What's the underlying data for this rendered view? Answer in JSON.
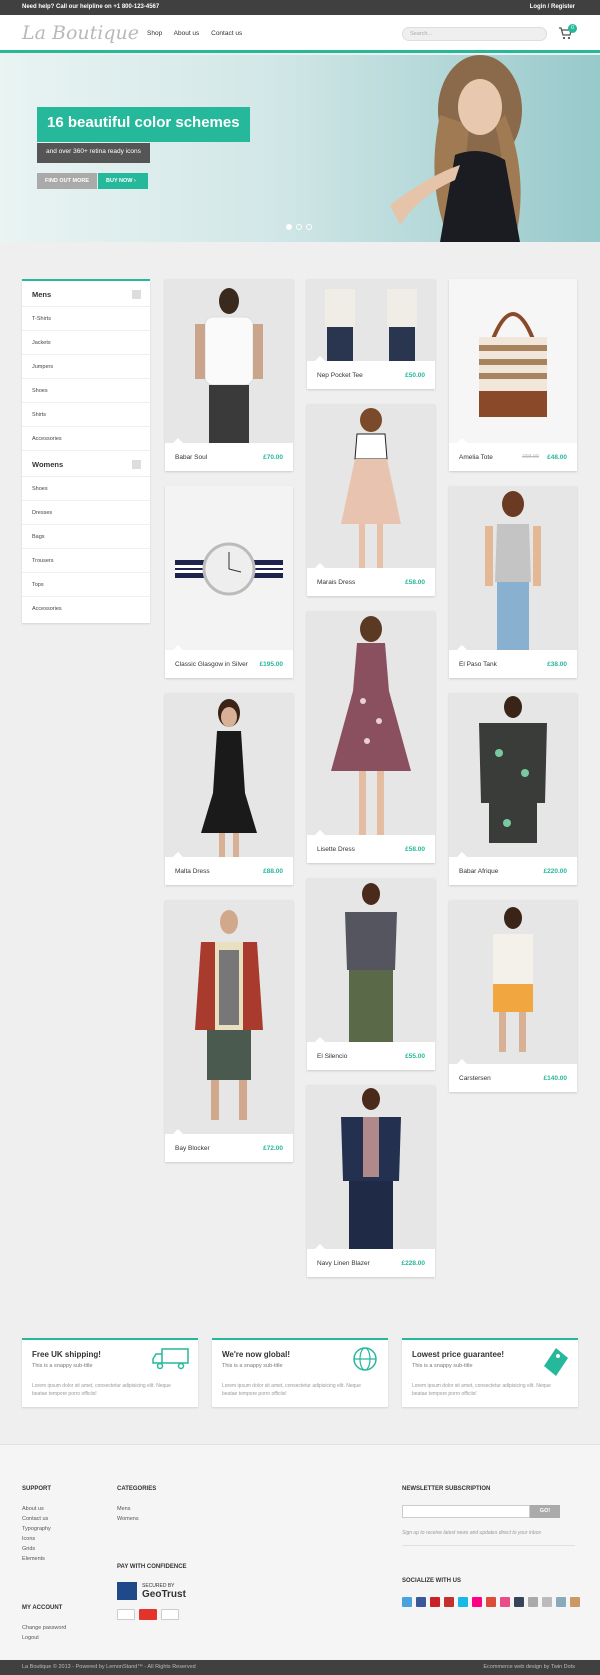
{
  "topbar": {
    "helpline": "Need help? Call our helpline on +1 800-123-4567",
    "login": "Login / Register"
  },
  "header": {
    "logo": "La Boutique",
    "nav": [
      "Shop",
      "About us",
      "Contact us"
    ],
    "search_placeholder": "Search...",
    "cart_count": "0"
  },
  "hero": {
    "title": "16 beautiful color schemes",
    "subtitle": "and over 360+ retina ready icons",
    "btn_more": "FIND OUT MORE",
    "btn_buy": "BUY NOW"
  },
  "sidebar": {
    "mens": {
      "title": "Mens",
      "items": [
        "T-Shirts",
        "Jackets",
        "Jumpers",
        "Shoes",
        "Shirts",
        "Accessories"
      ]
    },
    "womens": {
      "title": "Womens",
      "items": [
        "Shoes",
        "Dresses",
        "Bags",
        "Trousers",
        "Tops",
        "Accessories"
      ]
    }
  },
  "products": [
    {
      "name": "Babar Soul",
      "price": "£70.00"
    },
    {
      "name": "Classic Glasgow in Silver",
      "price": "£195.00"
    },
    {
      "name": "Malta Dress",
      "price": "£88.00"
    },
    {
      "name": "Bay Blocker",
      "price": "£72.00"
    },
    {
      "name": "Nep Pocket Tee",
      "price": "£50.00"
    },
    {
      "name": "Marais Dress",
      "price": "£58.00"
    },
    {
      "name": "Lisette Dress",
      "price": "£58.00"
    },
    {
      "name": "El Silencio",
      "price": "£55.00"
    },
    {
      "name": "Navy Linen Blazer",
      "price": "£228.00"
    },
    {
      "name": "Amelia Tote",
      "price": "£48.00",
      "old_price": "£58.00"
    },
    {
      "name": "El Paso Tank",
      "price": "£38.00"
    },
    {
      "name": "Babar Afrique",
      "price": "£220.00"
    },
    {
      "name": "Carstersen",
      "price": "£140.00"
    }
  ],
  "features": [
    {
      "title": "Free UK shipping!",
      "sub": "This is a snappy sub-title",
      "desc": "Lorem ipsum dolor sit amet, consectetur adipisicing elit. Neque beatae tempore porro officiis!"
    },
    {
      "title": "We're now global!",
      "sub": "This is a snappy sub-title",
      "desc": "Lorem ipsum dolor sit amet, consectetur adipisicing elit. Neque beatae tempore porro officiis!"
    },
    {
      "title": "Lowest price guarantee!",
      "sub": "This is a snappy sub-title",
      "desc": "Lorem ipsum dolor sit amet, consectetur adipisicing elit. Neque beatae tempore porro officiis!"
    }
  ],
  "footer": {
    "support_title": "SUPPORT",
    "support_links": [
      "About us",
      "Contact us",
      "Typography",
      "Icons",
      "Grids",
      "Elements"
    ],
    "account_title": "MY ACCOUNT",
    "account_links": [
      "Change password",
      "Logout"
    ],
    "categories_title": "CATEGORIES",
    "categories_links": [
      "Mens",
      "Womens"
    ],
    "pay_title": "PAY WITH CONFIDENCE",
    "geotrust_secured": "SECURED BY",
    "geotrust_brand": "GeoTrust",
    "newsletter_title": "NEWSLETTER SUBSCRIPTION",
    "newsletter_button": "GO!",
    "newsletter_note": "Sign up to receive latest news and updates direct to your inbox",
    "social_title": "SOCIALIZE WITH US",
    "copyright": "La Boutique © 2013 - Powered by LemonStand™ - All Rights Reserved",
    "credit": "Ecommerce web design by Twin Dots"
  },
  "colors": {
    "accent": "#26b89a",
    "dark": "#404040"
  }
}
